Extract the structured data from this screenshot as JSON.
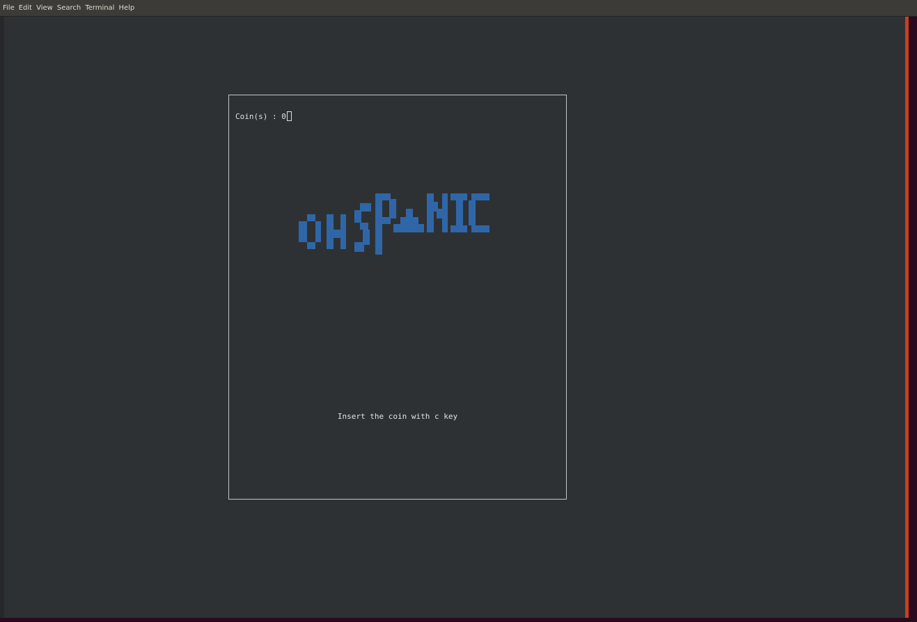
{
  "menubar": {
    "items": [
      "File",
      "Edit",
      "View",
      "Search",
      "Terminal",
      "Help"
    ]
  },
  "game": {
    "coins_label": "Coin(s) : ",
    "coins_value": "0",
    "title_logo": "OH SPANIC",
    "instruction": "Insert the coin with c key",
    "logo_color": "#2f66a8",
    "border_color": "#c4c4c4",
    "background_color": "#2e3134"
  }
}
